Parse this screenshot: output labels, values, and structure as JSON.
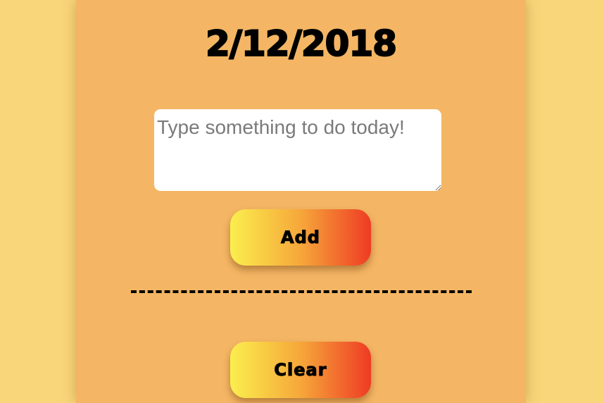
{
  "header": {
    "date": "2/12/2018"
  },
  "todo": {
    "placeholder": "Type something to do today!",
    "value": ""
  },
  "buttons": {
    "add_label": "Add",
    "clear_label": "Clear"
  },
  "colors": {
    "page_background": "#f9d67a",
    "card_background": "#f4b664",
    "button_gradient_start": "#fbee4e",
    "button_gradient_end": "#ee3b24"
  }
}
